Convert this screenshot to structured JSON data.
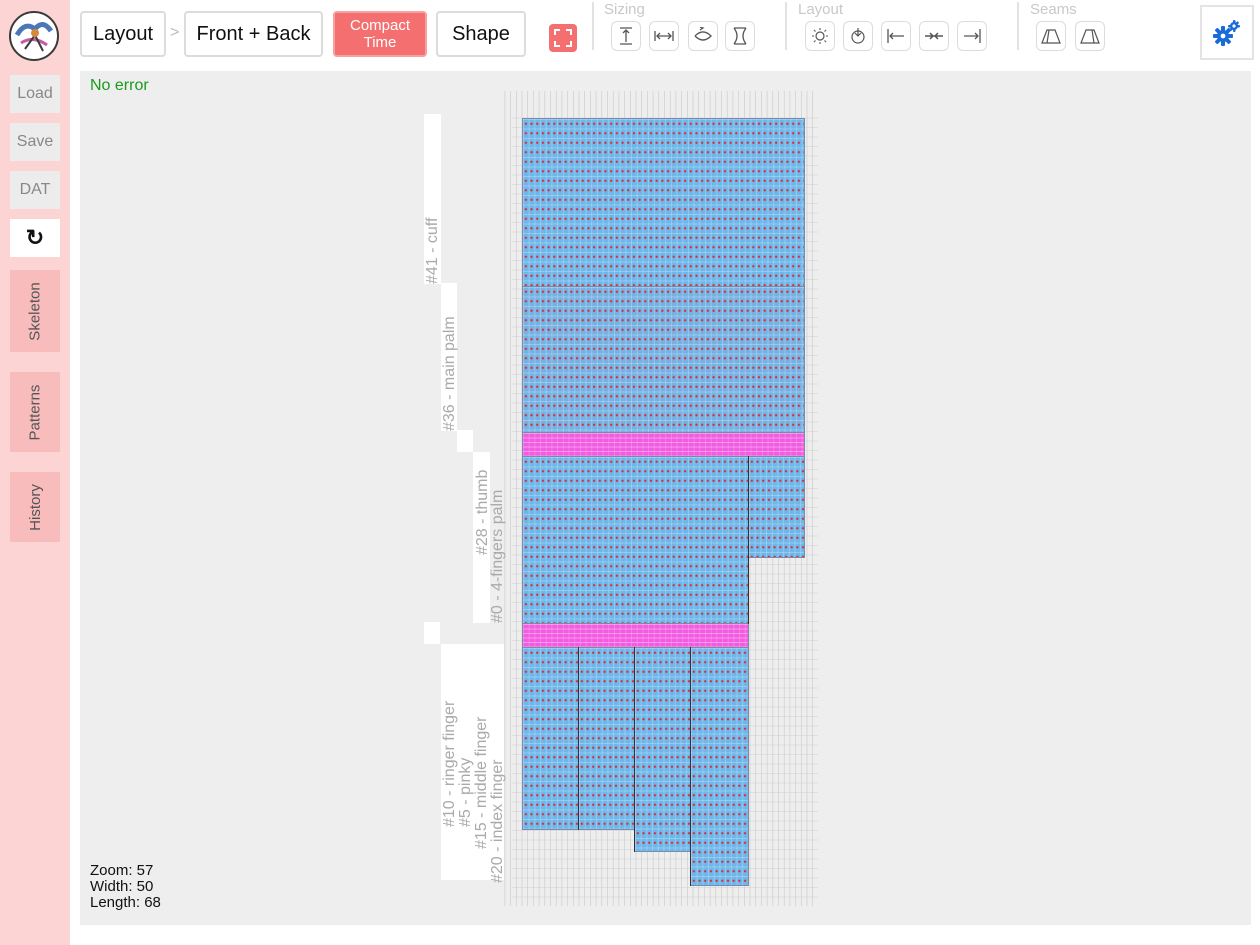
{
  "sidebar": {
    "load_label": "Load",
    "save_label": "Save",
    "dat_label": "DAT",
    "reload_icon": "↻",
    "tabs": [
      {
        "label": "Skeleton"
      },
      {
        "label": "Patterns"
      },
      {
        "label": "History"
      }
    ]
  },
  "toolbar": {
    "layout_label": "Layout",
    "separator": ">",
    "front_back_label": "Front + Back",
    "compact_line1": "Compact",
    "compact_line2": "Time",
    "shape_label": "Shape",
    "groups": {
      "sizing": "Sizing",
      "layout": "Layout",
      "seams": "Seams"
    }
  },
  "canvas": {
    "status": "No error",
    "zoom": "Zoom: 57",
    "width": "Width: 50",
    "length": "Length: 68",
    "labels": {
      "cuff": "#41 - cuff",
      "main_palm": "#36 - main palm",
      "thumb": "#28 - thumb",
      "fingers_palm": "#0 - 4-fingers palm",
      "ringer": "#10 - ringer finger",
      "pinky": "#5 - pinky",
      "middle": "#15 - middle finger",
      "index": "#20 - index finger"
    }
  },
  "colors": {
    "sidebar_bg": "#fcd4d4",
    "accent": "#f47070",
    "canvas_bg": "#eeeeee",
    "yarn_blue": "#6eb7ea",
    "yarn_pink": "#f25ce0",
    "status_ok": "#1a9a1a",
    "settings_icon": "#1a6ad8"
  }
}
